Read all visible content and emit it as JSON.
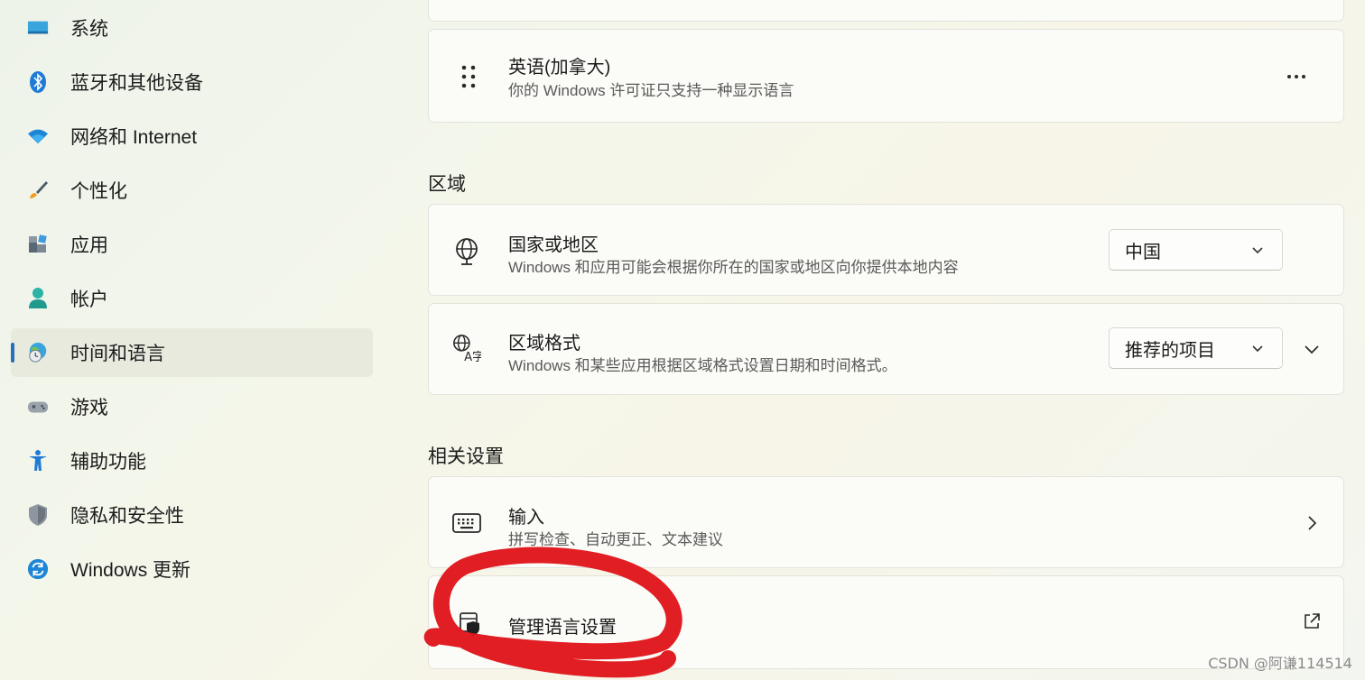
{
  "sidebar": {
    "items": [
      {
        "label": "系统",
        "icon": "monitor-icon"
      },
      {
        "label": "蓝牙和其他设备",
        "icon": "bluetooth-icon"
      },
      {
        "label": "网络和 Internet",
        "icon": "wifi-icon"
      },
      {
        "label": "个性化",
        "icon": "brush-icon"
      },
      {
        "label": "应用",
        "icon": "apps-icon"
      },
      {
        "label": "帐户",
        "icon": "person-icon"
      },
      {
        "label": "时间和语言",
        "icon": "globe-clock-icon",
        "selected": true
      },
      {
        "label": "游戏",
        "icon": "gamepad-icon"
      },
      {
        "label": "辅助功能",
        "icon": "accessibility-icon"
      },
      {
        "label": "隐私和安全性",
        "icon": "shield-icon"
      },
      {
        "label": "Windows 更新",
        "icon": "refresh-icon"
      }
    ]
  },
  "language_card": {
    "title": "英语(加拿大)",
    "subtitle": "你的 Windows 许可证只支持一种显示语言",
    "more_icon": "more-icon"
  },
  "region": {
    "heading": "区域",
    "country": {
      "title": "国家或地区",
      "subtitle": "Windows 和应用可能会根据你所在的国家或地区向你提供本地内容",
      "value": "中国"
    },
    "format": {
      "title": "区域格式",
      "subtitle": "Windows 和某些应用根据区域格式设置日期和时间格式。",
      "value": "推荐的项目"
    }
  },
  "related": {
    "heading": "相关设置",
    "input": {
      "title": "输入",
      "subtitle": "拼写检查、自动更正、文本建议"
    },
    "manage": {
      "title": "管理语言设置"
    }
  },
  "watermark": "CSDN @阿谦114514",
  "colors": {
    "accent": "#2a6fb7",
    "annotation": "#e0151a"
  }
}
